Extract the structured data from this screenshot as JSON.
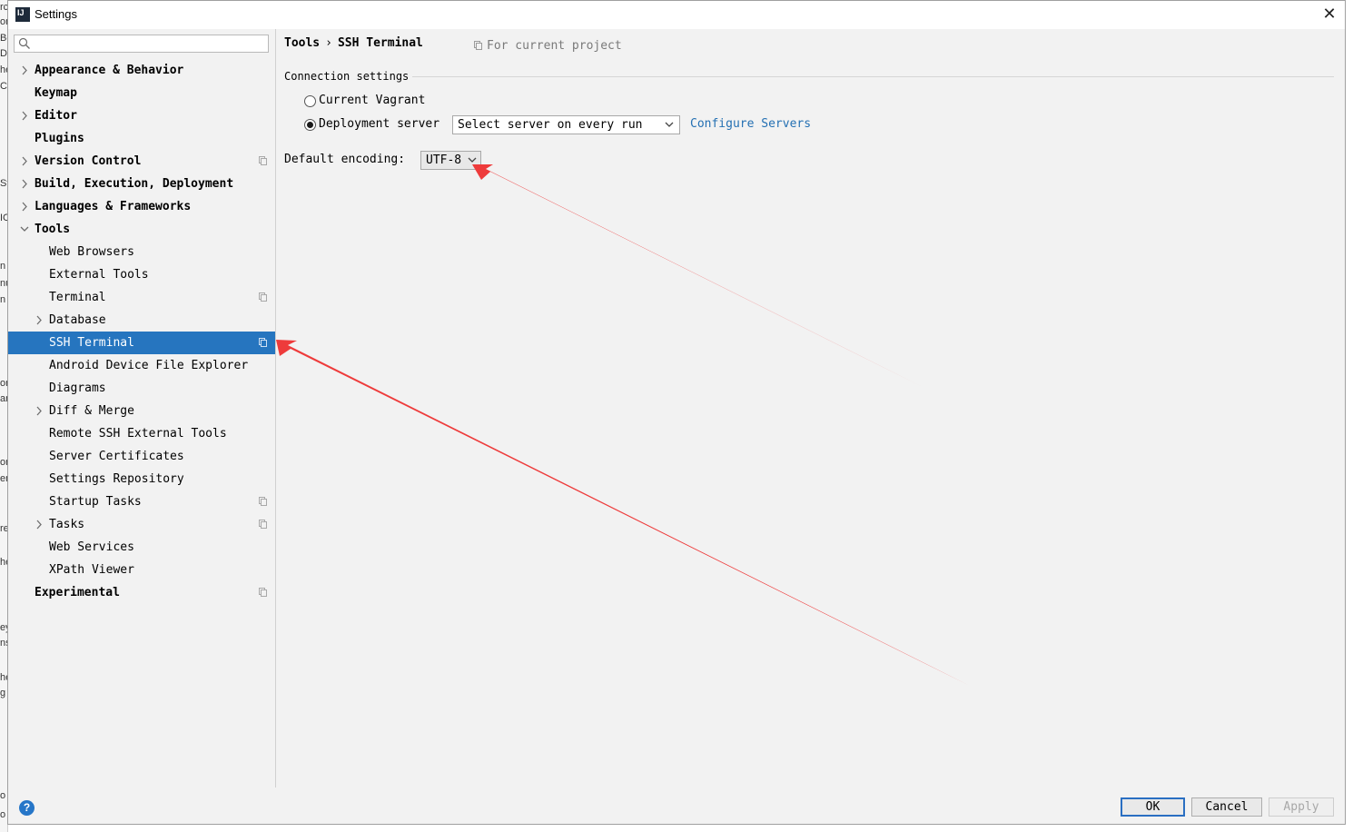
{
  "window": {
    "title": "Settings",
    "close_glyph": "✕"
  },
  "search": {
    "placeholder": "",
    "value": ""
  },
  "tree": {
    "items": [
      {
        "label": "Appearance & Behavior",
        "level": 0,
        "expandable": true,
        "expanded": false,
        "bold": true,
        "project_icon": false,
        "selected": false
      },
      {
        "label": "Keymap",
        "level": 0,
        "expandable": false,
        "expanded": false,
        "bold": true,
        "project_icon": false,
        "selected": false
      },
      {
        "label": "Editor",
        "level": 0,
        "expandable": true,
        "expanded": false,
        "bold": true,
        "project_icon": false,
        "selected": false
      },
      {
        "label": "Plugins",
        "level": 0,
        "expandable": false,
        "expanded": false,
        "bold": true,
        "project_icon": false,
        "selected": false
      },
      {
        "label": "Version Control",
        "level": 0,
        "expandable": true,
        "expanded": false,
        "bold": true,
        "project_icon": true,
        "selected": false
      },
      {
        "label": "Build, Execution, Deployment",
        "level": 0,
        "expandable": true,
        "expanded": false,
        "bold": true,
        "project_icon": false,
        "selected": false
      },
      {
        "label": "Languages & Frameworks",
        "level": 0,
        "expandable": true,
        "expanded": false,
        "bold": true,
        "project_icon": false,
        "selected": false
      },
      {
        "label": "Tools",
        "level": 0,
        "expandable": true,
        "expanded": true,
        "bold": true,
        "project_icon": false,
        "selected": false
      },
      {
        "label": "Web Browsers",
        "level": 1,
        "expandable": false,
        "expanded": false,
        "bold": false,
        "project_icon": false,
        "selected": false
      },
      {
        "label": "External Tools",
        "level": 1,
        "expandable": false,
        "expanded": false,
        "bold": false,
        "project_icon": false,
        "selected": false
      },
      {
        "label": "Terminal",
        "level": 1,
        "expandable": false,
        "expanded": false,
        "bold": false,
        "project_icon": true,
        "selected": false
      },
      {
        "label": "Database",
        "level": 1,
        "expandable": true,
        "expanded": false,
        "bold": false,
        "project_icon": false,
        "selected": false
      },
      {
        "label": "SSH Terminal",
        "level": 1,
        "expandable": false,
        "expanded": false,
        "bold": false,
        "project_icon": true,
        "selected": true
      },
      {
        "label": "Android Device File Explorer",
        "level": 1,
        "expandable": false,
        "expanded": false,
        "bold": false,
        "project_icon": false,
        "selected": false
      },
      {
        "label": "Diagrams",
        "level": 1,
        "expandable": false,
        "expanded": false,
        "bold": false,
        "project_icon": false,
        "selected": false
      },
      {
        "label": "Diff & Merge",
        "level": 1,
        "expandable": true,
        "expanded": false,
        "bold": false,
        "project_icon": false,
        "selected": false
      },
      {
        "label": "Remote SSH External Tools",
        "level": 1,
        "expandable": false,
        "expanded": false,
        "bold": false,
        "project_icon": false,
        "selected": false
      },
      {
        "label": "Server Certificates",
        "level": 1,
        "expandable": false,
        "expanded": false,
        "bold": false,
        "project_icon": false,
        "selected": false
      },
      {
        "label": "Settings Repository",
        "level": 1,
        "expandable": false,
        "expanded": false,
        "bold": false,
        "project_icon": false,
        "selected": false
      },
      {
        "label": "Startup Tasks",
        "level": 1,
        "expandable": false,
        "expanded": false,
        "bold": false,
        "project_icon": true,
        "selected": false
      },
      {
        "label": "Tasks",
        "level": 1,
        "expandable": true,
        "expanded": false,
        "bold": false,
        "project_icon": true,
        "selected": false
      },
      {
        "label": "Web Services",
        "level": 1,
        "expandable": false,
        "expanded": false,
        "bold": false,
        "project_icon": false,
        "selected": false
      },
      {
        "label": "XPath Viewer",
        "level": 1,
        "expandable": false,
        "expanded": false,
        "bold": false,
        "project_icon": false,
        "selected": false
      },
      {
        "label": "Experimental",
        "level": 0,
        "expandable": false,
        "expanded": false,
        "bold": true,
        "project_icon": true,
        "selected": false
      }
    ]
  },
  "content": {
    "breadcrumb": {
      "parent": "Tools",
      "separator": "›",
      "current": "SSH Terminal"
    },
    "scope_hint": "For current project",
    "connection": {
      "title": "Connection settings",
      "current_vagrant_label": "Current Vagrant",
      "current_vagrant_checked": false,
      "deployment_label": "Deployment server",
      "deployment_checked": true,
      "server_select_value": "Select server on every run",
      "configure_link": "Configure Servers"
    },
    "encoding": {
      "label": "Default encoding:",
      "value": "UTF-8"
    }
  },
  "footer": {
    "help_glyph": "?",
    "ok_label": "OK",
    "cancel_label": "Cancel",
    "apply_label": "Apply",
    "apply_enabled": false
  },
  "colors": {
    "selection": "#2675bf",
    "link": "#2470b3",
    "annotation_arrow": "#ee3b3b",
    "panel_bg": "#f2f2f2"
  },
  "background_fragments": [
    "rc",
    "or",
    "Be",
    "Da",
    "he",
    "Co",
    "St",
    "IC",
    "n",
    "nu",
    "n",
    "or",
    "ar",
    "or",
    "en",
    "re",
    "he",
    "ey",
    "ns",
    "he",
    "g",
    "o",
    "o"
  ]
}
